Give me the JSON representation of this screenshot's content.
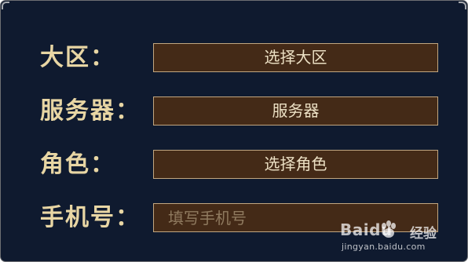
{
  "form": {
    "region": {
      "label": "大区：",
      "value": "选择大区"
    },
    "server": {
      "label": "服务器：",
      "value": "服务器"
    },
    "role": {
      "label": "角色：",
      "value": "选择角色"
    },
    "phone": {
      "label": "手机号：",
      "placeholder": "填写手机号"
    }
  },
  "watermark": {
    "brand": "Baidu",
    "product": "经验",
    "url": "jingyan.baidu.com"
  },
  "colors": {
    "background": "#0f1a2f",
    "label": "#e8d6a4",
    "field_fill": "#442a17",
    "field_border": "#c1a680"
  }
}
